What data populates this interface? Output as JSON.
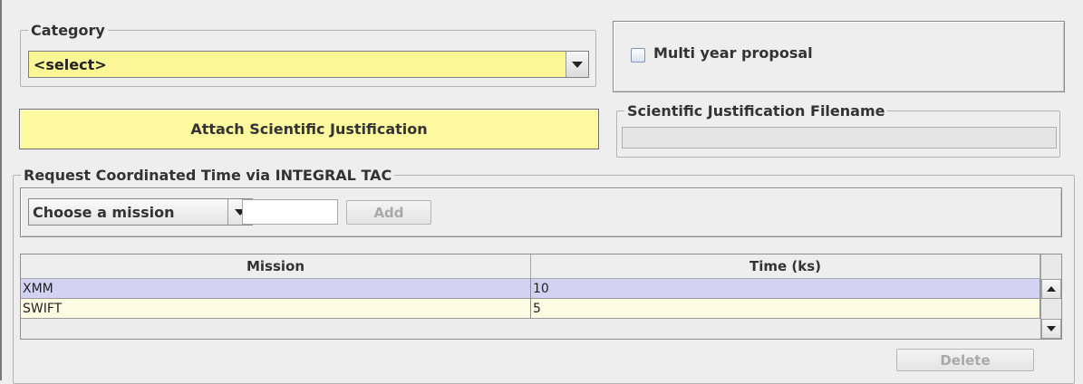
{
  "category": {
    "legend": "Category",
    "selected": "<select>"
  },
  "multi_year": {
    "label": "Multi year proposal",
    "checked": false
  },
  "attach_button": {
    "label": "Attach Scientific Justification"
  },
  "sci_filename": {
    "legend": "Scientific Justification Filename",
    "value": ""
  },
  "coordinated": {
    "legend": "Request Coordinated Time via INTEGRAL TAC",
    "mission_select": "Choose a mission",
    "time_value": "",
    "add_label": "Add"
  },
  "table": {
    "columns": [
      "Mission",
      "Time (ks)"
    ],
    "rows": [
      {
        "mission": "XMM",
        "time": "10"
      },
      {
        "mission": "SWIFT",
        "time": "5"
      }
    ]
  },
  "delete_button": {
    "label": "Delete"
  },
  "colors": {
    "highlight_yellow": "#fdf99e",
    "selected_row": "#d3d2f3",
    "alt_row": "#fdfbe1"
  }
}
